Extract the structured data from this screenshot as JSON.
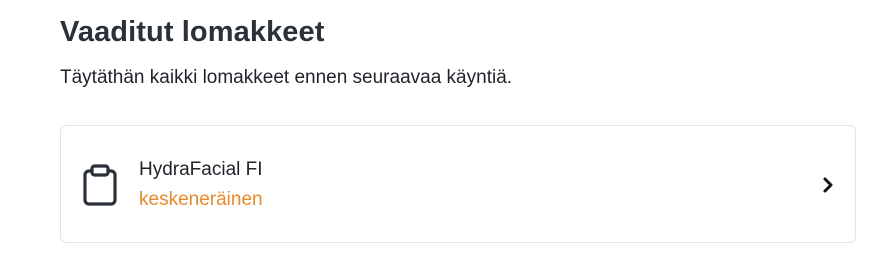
{
  "section": {
    "title": "Vaaditut lomakkeet",
    "subtitle": "Täytäthän kaikki lomakkeet ennen seuraavaa käyntiä."
  },
  "forms": [
    {
      "name": "HydraFacial FI",
      "status": "keskeneräinen",
      "status_color": "#e8892c",
      "icon": "clipboard-icon"
    }
  ],
  "colors": {
    "text": "#1f2329",
    "title": "#2b313a",
    "status_in_progress": "#e8892c",
    "card_border": "#e3e5e8"
  }
}
